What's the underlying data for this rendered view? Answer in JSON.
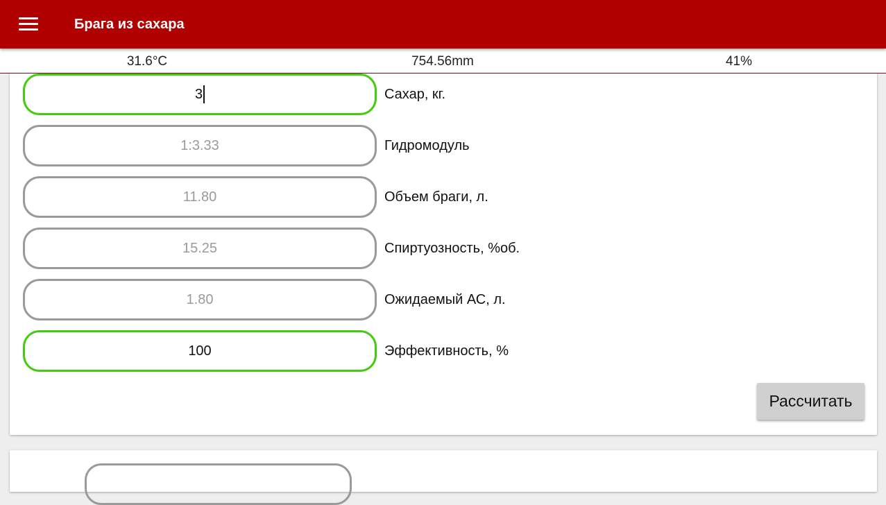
{
  "app_bar": {
    "title": "Брага из сахара",
    "menu_icon": "hamburger-menu-icon",
    "color": "#b00000"
  },
  "status": {
    "temperature": "31.6°C",
    "pressure": "754.56mm",
    "humidity": "41%"
  },
  "form": {
    "rows": [
      {
        "value": "3",
        "label": "Сахар, кг.",
        "state": "active-input"
      },
      {
        "value": "1:3.33",
        "label": "Гидромодуль",
        "state": "readonly"
      },
      {
        "value": "11.80",
        "label": "Объем браги, л.",
        "state": "readonly"
      },
      {
        "value": "15.25",
        "label": "Спиртуозность, %об.",
        "state": "readonly"
      },
      {
        "value": "1.80",
        "label": "Ожидаемый АС, л.",
        "state": "readonly"
      },
      {
        "value": "100",
        "label": "Эффективность, %",
        "state": "active-input"
      }
    ],
    "calculate_label": "Рассчитать",
    "active_border_color": "#44cc11",
    "inactive_border_color": "#9a9a9a"
  }
}
